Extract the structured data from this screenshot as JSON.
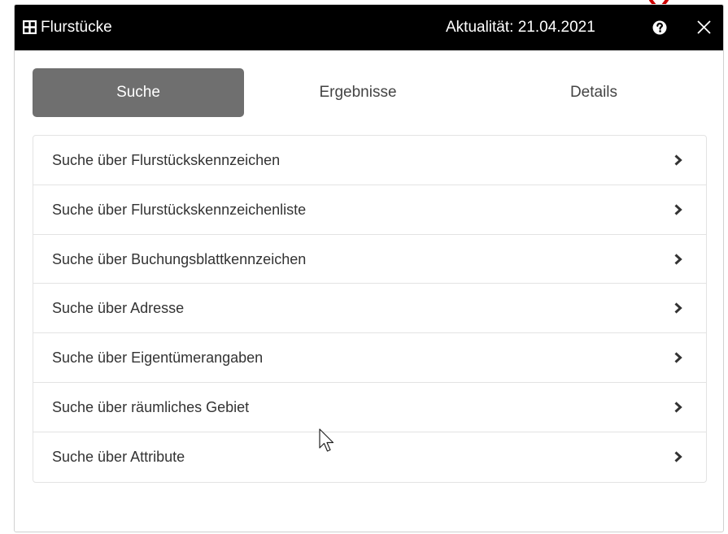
{
  "window": {
    "title": "Flurstücke",
    "actuality": "Aktualität: 21.04.2021",
    "icons": {
      "app": "grid-table-icon",
      "help": "question-circle-icon",
      "close": "close-icon"
    }
  },
  "tabs": [
    {
      "label": "Suche",
      "active": true
    },
    {
      "label": "Ergebnisse",
      "active": false
    },
    {
      "label": "Details",
      "active": false
    }
  ],
  "search_options": [
    {
      "label": "Suche über Flurstückskennzeichen"
    },
    {
      "label": "Suche über Flurstückskennzeichenliste"
    },
    {
      "label": "Suche über Buchungsblattkennzeichen"
    },
    {
      "label": "Suche über Adresse"
    },
    {
      "label": "Suche über Eigentümerangaben"
    },
    {
      "label": "Suche über räumliches Gebiet"
    },
    {
      "label": "Suche über Attribute"
    }
  ],
  "colors": {
    "titlebar": "#000000",
    "active_tab": "#6f6f6f",
    "annotation": "#cc0000"
  }
}
